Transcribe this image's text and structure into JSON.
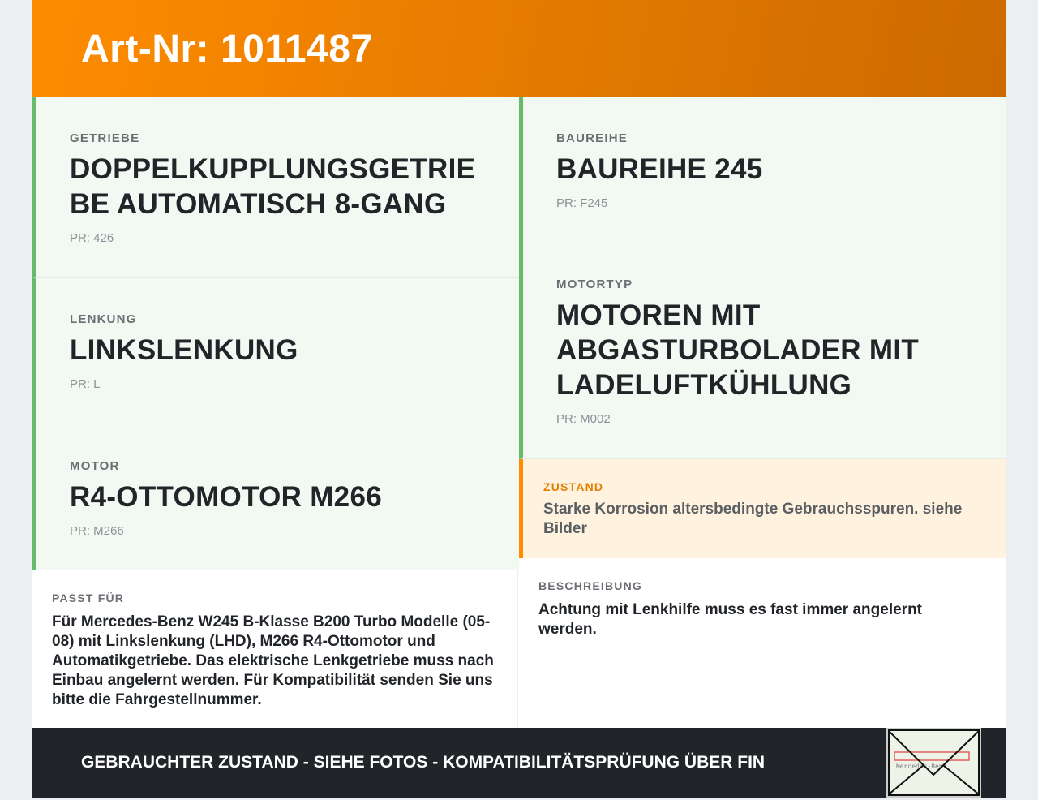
{
  "header": {
    "title": "Art-Nr: 1011487"
  },
  "specs": {
    "getriebe": {
      "label": "GETRIEBE",
      "value": "DOPPELKUPPLUNGSGETRIEBE AUTOMATISCH 8-GANG",
      "pr": "PR: 426"
    },
    "lenkung": {
      "label": "LENKUNG",
      "value": "LINKSLENKUNG",
      "pr": "PR: L"
    },
    "motor": {
      "label": "MOTOR",
      "value": "R4-OTTOMOTOR M266",
      "pr": "PR: M266"
    },
    "baureihe": {
      "label": "BAUREIHE",
      "value": "BAUREIHE 245",
      "pr": "PR: F245"
    },
    "motortyp": {
      "label": "MOTORTYP",
      "value": "MOTOREN MIT ABGASTURBOLADER MIT LADELUFTKÜHLUNG",
      "pr": "PR: M002"
    }
  },
  "zustand": {
    "label": "ZUSTAND",
    "text": "Starke Korrosion altersbedingte Gebrauchsspuren. siehe Bilder"
  },
  "passt": {
    "label": "PASST FÜR",
    "text": "Für Mercedes-Benz W245 B-Klasse B200 Turbo Modelle (05-08) mit Linkslenkung (LHD), M266 R4-Ottomotor und Automatikgetriebe. Das elektrische Lenkgetriebe muss nach Einbau angelernt werden. Für Kompatibilität senden Sie uns bitte die Fahrgestellnummer."
  },
  "beschreibung": {
    "label": "BESCHREIBUNG",
    "text": "Achtung mit Lenkhilfe muss es fast immer angelernt werden."
  },
  "footer": {
    "text": "GEBRAUCHTER ZUSTAND - SIEHE FOTOS - KOMPATIBILITÄTSPRÜFUNG ÜBER FIN",
    "thumb_text": "Mercedes-Benz"
  }
}
